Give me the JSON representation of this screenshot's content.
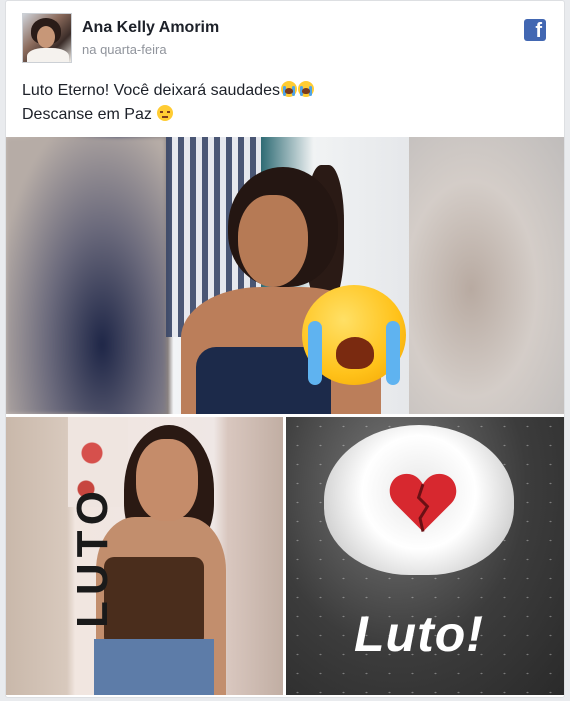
{
  "post": {
    "author_name": "Ana Kelly Amorim",
    "timestamp": "na quarta-feira",
    "platform_icon": "facebook-icon",
    "text_line1": "Luto Eterno! Você deixará saudades",
    "text_line2": "Descanse em Paz"
  },
  "photos": [
    {
      "name": "photo-main",
      "sticker": "loudly-crying-emoji"
    },
    {
      "name": "photo-luto-vertical",
      "overlay_text": "LUTO"
    },
    {
      "name": "photo-white-rose",
      "overlay_text": "Luto!",
      "sticker": "broken-heart-emoji"
    }
  ],
  "colors": {
    "facebook_blue": "#4267b2",
    "text": "#1d2129",
    "meta_text": "#90949c",
    "card_border": "#dddfe2"
  }
}
